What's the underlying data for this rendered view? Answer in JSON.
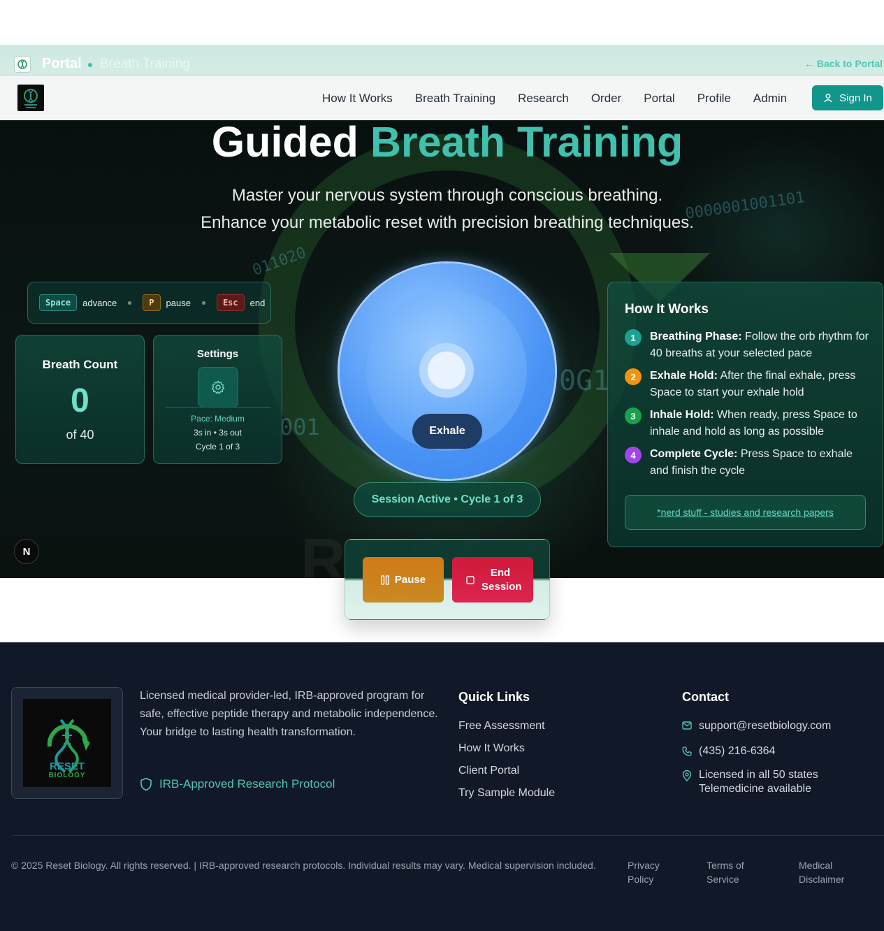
{
  "portal_bar": {
    "title": "Portal",
    "subtitle": "Breath Training",
    "back_link": "← Back to Portal"
  },
  "nav": {
    "links": [
      "How It Works",
      "Breath Training",
      "Research",
      "Order",
      "Portal",
      "Profile",
      "Admin"
    ],
    "sign_in": "Sign In"
  },
  "hero": {
    "title_plain": "Guided",
    "title_accent": "Breath Training",
    "subtitle_1": "Master your nervous system through conscious breathing.",
    "subtitle_2": "Enhance your metabolic reset with precision breathing techniques.",
    "bg_binary_1": "0000001001101",
    "bg_binary_2": "011020",
    "bg_binary_3": "0G1",
    "bg_binary_4": "001",
    "bg_watermark": "RESET"
  },
  "shortcuts": {
    "space_key": "Space",
    "space_action": "advance",
    "p_key": "P",
    "p_action": "pause",
    "esc_key": "Esc",
    "esc_action": "end"
  },
  "breath_count": {
    "title": "Breath Count",
    "count": "0",
    "of_label": "of 40"
  },
  "settings": {
    "title": "Settings",
    "pace": "Pace: Medium",
    "timing": "3s in • 3s out",
    "cycle": "Cycle 1 of 3"
  },
  "orb": {
    "phase_label": "Exhale"
  },
  "session": {
    "status": "Session Active • Cycle 1 of 3"
  },
  "how_it_works": {
    "title": "How It Works",
    "steps": [
      {
        "num": "1",
        "title": "Breathing Phase:",
        "text": "Follow the orb rhythm for 40 breaths at your selected pace",
        "color": "#1aa394"
      },
      {
        "num": "2",
        "title": "Exhale Hold:",
        "text": "After the final exhale, press Space to start your exhale hold",
        "color": "#f29410"
      },
      {
        "num": "3",
        "title": "Inhale Hold:",
        "text": "When ready, press Space to inhale and hold as long as possible",
        "color": "#16a34a"
      },
      {
        "num": "4",
        "title": "Complete Cycle:",
        "text": "Press Space to exhale and finish the cycle",
        "color": "#a045e8"
      }
    ],
    "research_link": "*nerd stuff - studies and research papers"
  },
  "n_badge": "N",
  "controls": {
    "pause": "Pause",
    "end_session": "End Session"
  },
  "footer": {
    "logo_text_1": "RESET",
    "logo_text_2": "BIOLOGY",
    "description": "Licensed medical provider-led, IRB-approved program for safe, effective peptide therapy and metabolic independence. Your bridge to lasting health transformation.",
    "irb_badge": "IRB-Approved Research Protocol",
    "quick_links_title": "Quick Links",
    "quick_links": [
      "Free Assessment",
      "How It Works",
      "Client Portal",
      "Try Sample Module"
    ],
    "contact_title": "Contact",
    "email": "support@resetbiology.com",
    "phone": "(435) 216-6364",
    "licensed": "Licensed in all 50 states",
    "telemedicine": "Telemedicine available",
    "copyright": "© 2025 Reset Biology. All rights reserved. | IRB-approved research protocols. Individual results may vary. Medical supervision included.",
    "privacy": "Privacy Policy",
    "terms": "Terms of Service",
    "disclaimer": "Medical Disclaimer"
  },
  "colors": {
    "accent": "#40c0ad",
    "primary_button": "#12958a",
    "pause_button": "#d07a18",
    "end_button": "#cf1a38",
    "footer_bg": "#111827",
    "orb": "#4b94f5"
  }
}
